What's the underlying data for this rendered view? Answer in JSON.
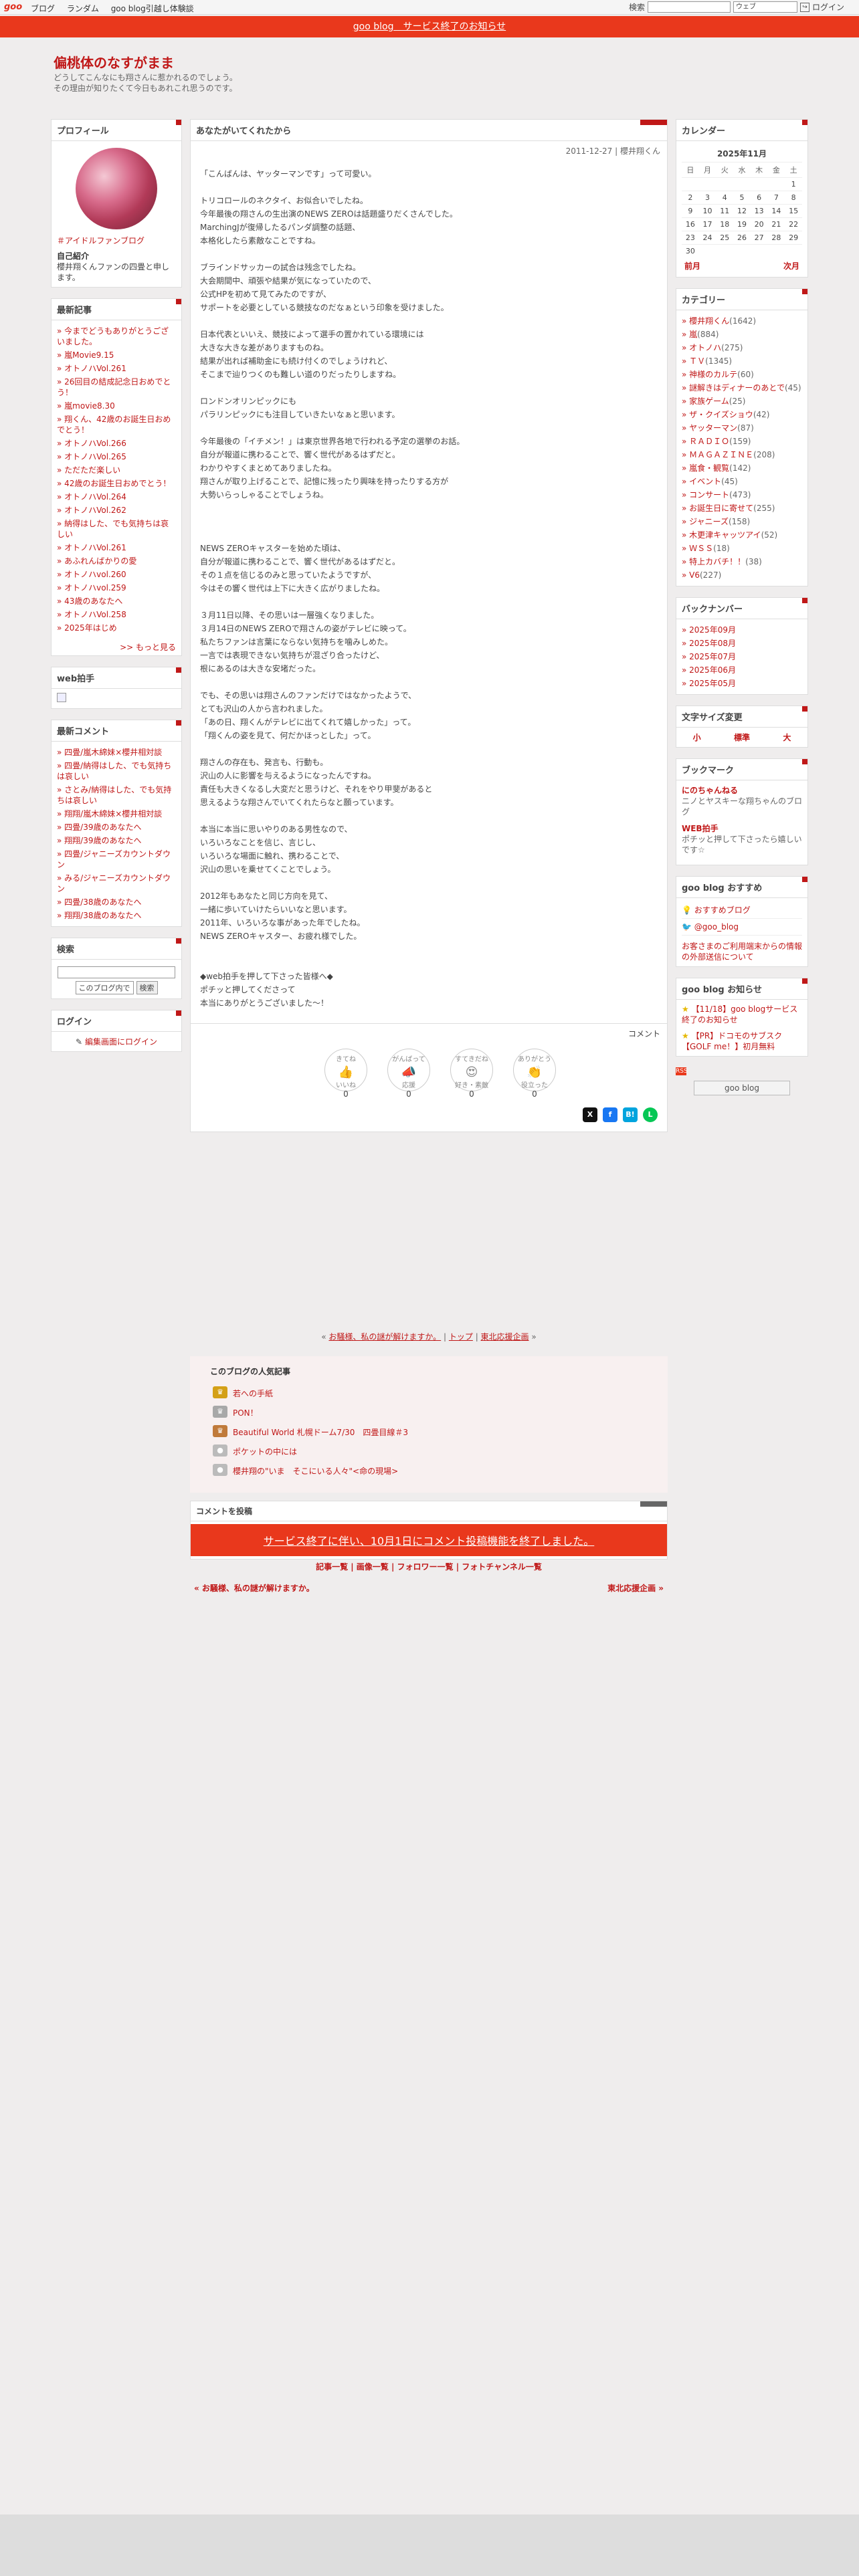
{
  "gbar": {
    "logo": "goo",
    "nav": [
      "ブログ",
      "ランダム",
      "goo blog引越し体験談"
    ],
    "search_label": "検索",
    "search_scope": "ウェブ",
    "login": "ログイン"
  },
  "notice": "goo blog　サービス終了のお知らせ",
  "blog": {
    "title": "偏桃体のなすがまま",
    "desc1": "どうしてこんなにも翔さんに惹かれるのでしょう。",
    "desc2": "その理由が知りたくて今日もあれこれ思うのです。"
  },
  "left": {
    "profile_h": "プロフィール",
    "profile_tag": "＃アイドルファンブログ",
    "self_h": "自己紹介",
    "self_text": "櫻井翔くんファンの四畳と申します。",
    "recent_h": "最新記事",
    "recent": [
      "今までどうもありがとうございました。",
      "嵐Movie9.15",
      "オトノハVol.261",
      "26回目の結成記念日おめでとう！",
      "嵐movie8.30",
      "翔くん、42歳のお誕生日おめでとう！",
      "オトノハVol.266",
      "オトノハVol.265",
      "ただただ楽しい",
      "42歳のお誕生日おめでとう！",
      "オトノハVol.264",
      "オトノハVol.262",
      "納得はした、でも気持ちは哀しい",
      "オトノハVol.261",
      "あふれんばかりの愛",
      "オトノハvol.260",
      "オトノハvol.259",
      "43歳のあなたへ",
      "オトノハVol.258",
      "2025年はじめ"
    ],
    "more": ">> もっと見る",
    "webclap_h": "web拍手",
    "comments_h": "最新コメント",
    "comments": [
      "四畳/嵐木綿妹×櫻井相対談",
      "四畳/納得はした、でも気持ちは哀しい",
      "さとみ/納得はした、でも気持ちは哀しい",
      "翔翔/嵐木綿妹×櫻井相対談",
      "四畳/39歳のあなたへ",
      "翔翔/39歳のあなたへ",
      "四畳/ジャニーズカウントダウン",
      "みる/ジャニーズカウントダウン",
      "四畳/38歳のあなたへ",
      "翔翔/38歳のあなたへ"
    ],
    "search_h": "検索",
    "search_scope": "このブログ内で",
    "search_btn": "検索",
    "login_h": "ログイン",
    "login_link": "編集画面にログイン"
  },
  "post": {
    "title": "あなたがいてくれたから",
    "meta": "2011-12-27 | 櫻井翔くん",
    "body": "「こんばんは、ヤッターマンです」って可愛い。\n\nトリコロールのネクタイ、お似合いでしたね。\n今年最後の翔さんの生出演のNEWS ZEROは話題盛りだくさんでした。\nMarchingJが復帰したるパンダ調整の話題、\n本格化したら素敵なことですね。\n\nブラインドサッカーの試合は残念でしたね。\n大会期間中、頑張や結果が気になっていたので、\n公式HPを初めて見てみたのですが、\nサポートを必要としている競技なのだなぁという印象を受けました。\n\n日本代表といいえ、競技によって選手の置かれている環境には\n大きな大きな差がありますものね。\n結果が出れば補助金にも続け付くのでしょうけれど、\nそこまで辿りつくのも難しい道のりだったりしますね。\n\nロンドンオリンピックにも\nパラリンピックにも注目していきたいなぁと思います。\n\n今年最後の「イチメン！」は東京世界各地で行われる予定の選挙のお話。\n自分が報道に携わることで、響く世代があるはずだと。\nわかりやすくまとめてありましたね。\n翔さんが取り上げることで、記憶に残ったり興味を持ったりする方が\n大勢いらっしゃることでしょうね。\n\n\n\nNEWS ZEROキャスターを始めた頃は、\n自分が報道に携わることで、響く世代があるはずだと。\nその１点を信じるのみと思っていたようですが、\n今はその響く世代は上下に大きく広がりましたね。\n\n３月11日以降、その思いは一層強くなりました。\n３月14日のNEWS ZEROで翔さんの姿がテレビに映って。\n私たちファンは言葉にならない気持ちを噛みしめた。\n一言では表現できない気持ちが混ざり合ったけど、\n根にあるのは大きな安堵だった。\n\nでも、その思いは翔さんのファンだけではなかったようで、\nとても沢山の人から言われました。\n「あの日、翔くんがテレビに出てくれて嬉しかった」って。\n「翔くんの姿を見て、何だかほっとした」って。\n\n翔さんの存在も、発言も、行動も。\n沢山の人に影響を与えるようになったんですね。\n責任も大きくなるし大変だと思うけど、それをやり甲斐があると\n思えるような翔さんでいてくれたらなと願っています。\n\n本当に本当に思いやりのある男性なので、\nいろいろなことを信じ、言じし、\nいろいろな場面に触れ、携わることで、\n沢山の思いを乗せてくことでしょう。\n\n2012年もあなたと同じ方向を見て、\n一緒に歩いていけたらいいなと思います。\n2011年、いろいろな事があった年でしたね。\nNEWS ZEROキャスター、お疲れ様でした。\n\n\n◆web拍手を押して下さった皆様へ◆\nポチッと押してくださって\n本当にありがとうございました〜！",
    "comment_link": "コメント",
    "reactions": [
      {
        "label": "いいね",
        "top": "きてね",
        "count": "0",
        "icon": "thumbs-up"
      },
      {
        "label": "応援",
        "top": "がんばって",
        "count": "0",
        "icon": "megaphone"
      },
      {
        "label": "好き・素敵",
        "top": "すてきだね",
        "count": "0",
        "icon": "heart-eyes"
      },
      {
        "label": "役立った",
        "top": "ありがとう",
        "count": "0",
        "icon": "clap"
      }
    ]
  },
  "right": {
    "calendar_h": "カレンダー",
    "month": "2025年11月",
    "weekdays": [
      "日",
      "月",
      "火",
      "水",
      "木",
      "金",
      "土"
    ],
    "weeks": [
      [
        "",
        "",
        "",
        "",
        "",
        "",
        "1"
      ],
      [
        "2",
        "3",
        "4",
        "5",
        "6",
        "7",
        "8"
      ],
      [
        "9",
        "10",
        "11",
        "12",
        "13",
        "14",
        "15"
      ],
      [
        "16",
        "17",
        "18",
        "19",
        "20",
        "21",
        "22"
      ],
      [
        "23",
        "24",
        "25",
        "26",
        "27",
        "28",
        "29"
      ],
      [
        "30",
        "",
        "",
        "",
        "",
        "",
        ""
      ]
    ],
    "prev": "前月",
    "next": "次月",
    "cat_h": "カテゴリー",
    "categories": [
      {
        "name": "櫻井翔くん",
        "count": "(1642)"
      },
      {
        "name": "嵐",
        "count": "(884)"
      },
      {
        "name": "オトノハ",
        "count": "(275)"
      },
      {
        "name": "ＴＶ",
        "count": "(1345)"
      },
      {
        "name": "神様のカルテ",
        "count": "(60)"
      },
      {
        "name": "謎解きはディナーのあとで",
        "count": "(45)"
      },
      {
        "name": "家族ゲーム",
        "count": "(25)"
      },
      {
        "name": "ザ・クイズショウ",
        "count": "(42)"
      },
      {
        "name": "ヤッターマン",
        "count": "(87)"
      },
      {
        "name": "ＲＡＤＩＯ",
        "count": "(159)"
      },
      {
        "name": "ＭＡＧＡＺＩＮＥ",
        "count": "(208)"
      },
      {
        "name": "嵐食・観覧",
        "count": "(142)"
      },
      {
        "name": "イベント",
        "count": "(45)"
      },
      {
        "name": "コンサート",
        "count": "(473)"
      },
      {
        "name": "お誕生日に寄せて",
        "count": "(255)"
      },
      {
        "name": "ジャニーズ",
        "count": "(158)"
      },
      {
        "name": "木更津キャッツアイ",
        "count": "(52)"
      },
      {
        "name": "ＷＳＳ",
        "count": "(18)"
      },
      {
        "name": "特上カバチ！！",
        "count": "(38)"
      },
      {
        "name": "V6",
        "count": "(227)"
      }
    ],
    "backnum_h": "バックナンバー",
    "backnum": [
      "2025年09月",
      "2025年08月",
      "2025年07月",
      "2025年06月",
      "2025年05月"
    ],
    "fontsize_h": "文字サイズ変更",
    "fontsizes": [
      "小",
      "標準",
      "大"
    ],
    "bookmark_h": "ブックマーク",
    "bookmarks": [
      {
        "t": "にのちゃんねる",
        "d": "ニノとヤスキーな翔ちゃんのブログ"
      },
      {
        "t": "WEB拍手",
        "d": "ポチッと押して下さったら嬉しいです☆"
      }
    ],
    "recommend_h": "goo blog おすすめ",
    "recommend": [
      "おすすめブログ",
      "@goo_blog"
    ],
    "recommend_notice": "お客さまのご利用端末からの情報の外部送信について",
    "info_h": "goo blog お知らせ",
    "info": [
      "【11/18】goo blogサービス終了のお知らせ",
      "【PR】ドコモのサブスク【GOLF me！】初月無料"
    ],
    "gooblog_btn": "goo blog"
  },
  "bottom": {
    "prev_title": "お騒様、私の謎が解けますか。",
    "top": "トップ",
    "next_title": "東北応援企画",
    "popular_h": "このブログの人気記事",
    "popular": [
      "若への手紙",
      "PON！",
      "Beautiful World 札幌ドーム7/30　四畳目線＃3",
      "ポケットの中には",
      "櫻井翔の\"いま　そこにいる人々\"<命の現場>"
    ],
    "comment_h": "コメントを投稿",
    "comment_closed": "サービス終了に伴い、10月1日にコメント投稿機能を終了しました。",
    "links": "記事一覧 | 画像一覧 | フォロワー一覧 | フォトチャンネル一覧",
    "prev_label": "« お騒様、私の謎が解けますか。",
    "next_label": "東北応援企画 »"
  }
}
